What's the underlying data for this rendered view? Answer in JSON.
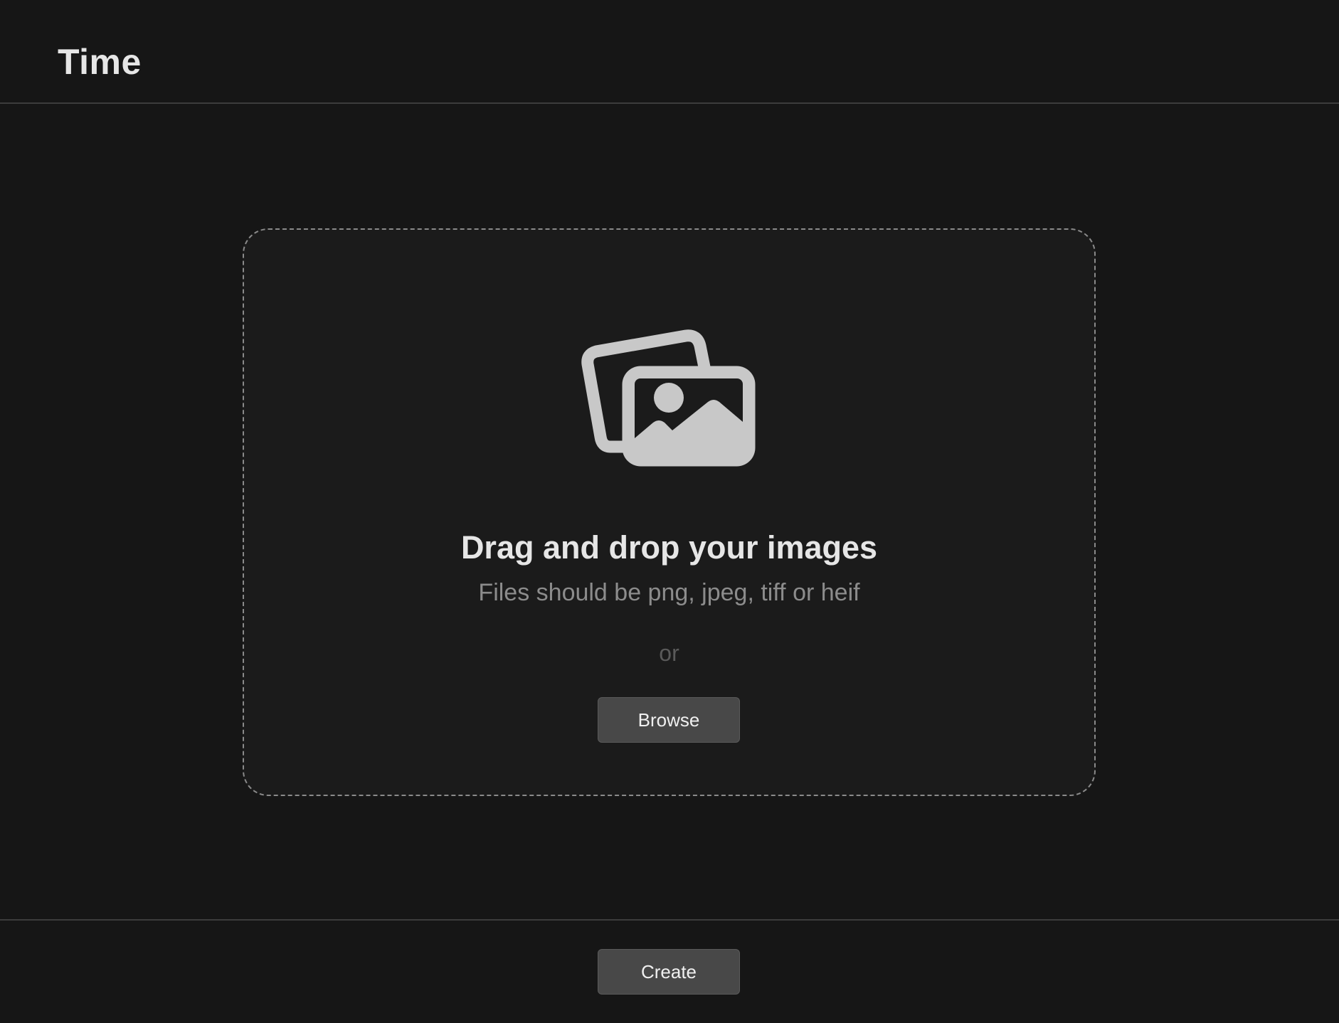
{
  "header": {
    "title": "Time"
  },
  "dropzone": {
    "icon": "photos-icon",
    "heading": "Drag and drop your images",
    "hint": "Files should be png, jpeg, tiff or heif",
    "separator": "or",
    "browse_label": "Browse"
  },
  "footer": {
    "create_label": "Create"
  },
  "colors": {
    "background": "#161616",
    "dropzone_background": "#1b1b1b",
    "dropzone_border": "#8a8a8a",
    "button_background": "#484848",
    "icon": "#c8c8c8"
  }
}
